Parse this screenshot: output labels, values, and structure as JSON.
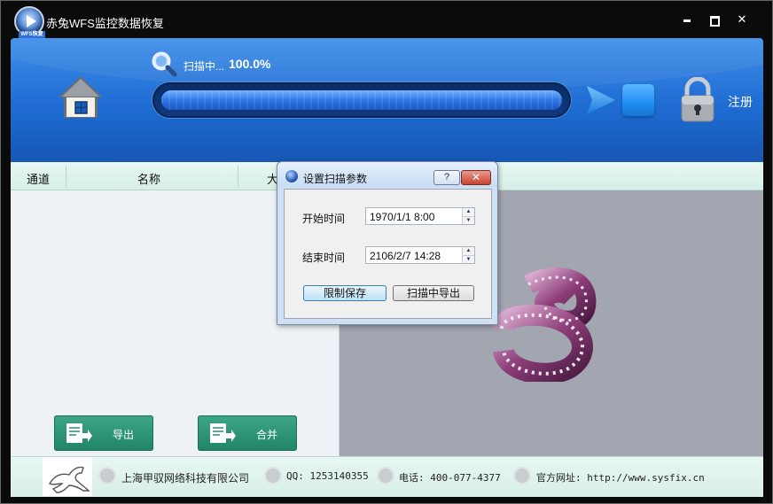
{
  "window": {
    "title": "赤兔WFS监控数据恢复",
    "logo_tag": "WFS恢复"
  },
  "scan": {
    "status": "扫描中...",
    "percent": "100.0%",
    "progress": 1.0
  },
  "header": {
    "register_label": "注册"
  },
  "table": {
    "columns": [
      "通道",
      "名称",
      "大"
    ]
  },
  "actions": {
    "export_label": "导出",
    "merge_label": "合并"
  },
  "dialog": {
    "title": "设置扫描参数",
    "help_label": "?",
    "start_label": "开始时间",
    "start_value": "1970/1/1 8:00",
    "end_label": "结束时间",
    "end_value": "2106/2/7 14:28",
    "limit_save_label": "限制保存",
    "scan_export_label": "扫描中导出"
  },
  "footer": {
    "company": "上海甲驭网络科技有限公司",
    "qq": "QQ: 1253140355",
    "phone": "电话: 400-077-4377",
    "website": "官方网址: http://www.sysfix.cn"
  },
  "icons": {
    "home": "home-icon",
    "search": "search-icon",
    "play": "play-icon",
    "stop": "stop-icon",
    "lock": "lock-icon",
    "film": "film-reel-image"
  }
}
